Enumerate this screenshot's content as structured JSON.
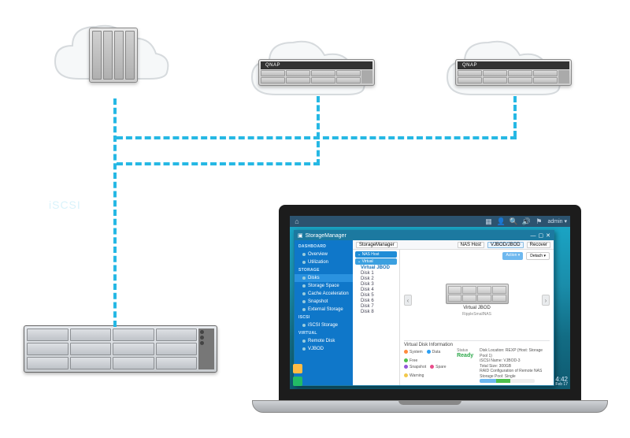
{
  "iscsi_label": "iSCSI",
  "devices": {
    "rack2_brand": "QNAP",
    "rack3_brand": "QNAP"
  },
  "laptop": {
    "topbar": {
      "user": "admin ▾"
    },
    "clock": {
      "time": "4:42",
      "date": "Feb 17"
    },
    "window": {
      "title": "StorageManager",
      "sidebar": {
        "sections": [
          {
            "label": "DASHBOARD",
            "items": [
              "Overview",
              "Utilization"
            ]
          },
          {
            "label": "STORAGE",
            "items": [
              "Disks",
              "Storage Space",
              "Cache Acceleration",
              "Snapshot",
              "External Storage"
            ]
          },
          {
            "label": "iSCSI",
            "items": [
              "iSCSI Storage"
            ]
          },
          {
            "label": "VIRTUAL",
            "items": [
              "Remote Disk",
              "VJBOD"
            ]
          }
        ],
        "active": "Disks"
      },
      "toolbar": {
        "breadcrumb": "StorageManager",
        "tool1": "NAS Host",
        "tool2": "VJBOD/JBOD",
        "tool3": "Recover"
      },
      "tree": {
        "header": "⌄ NAS Host",
        "vnode": "⌄ Virtual",
        "disks": [
          "Virtual JBOD",
          "Disk 1",
          "Disk 2",
          "Disk 3",
          "Disk 4",
          "Disk 5",
          "Disk 6",
          "Disk 7",
          "Disk 8"
        ]
      },
      "viewer": {
        "title": "Virtual JBOD",
        "subtitle": "RippleSmallNAS",
        "actions": {
          "a1": "Action ▾",
          "a2": "Detach ▾"
        }
      },
      "info": {
        "title": "Virtual Disk Information",
        "status_label": "Status",
        "status_value": "Ready",
        "legend": {
          "system": "System",
          "data": "Data",
          "free": "Free",
          "snap": "Snapshot",
          "spare": "Spare",
          "warn": "Warning"
        },
        "details": {
          "location": "Disk Location: REXP (Host: Storage Pool 1)",
          "name": "iSCSI Name: VJBOD-3",
          "size": "Total Size: 300GB",
          "config": "RAID Configuration of Remote NAS Storage Pool: Single"
        }
      }
    }
  }
}
